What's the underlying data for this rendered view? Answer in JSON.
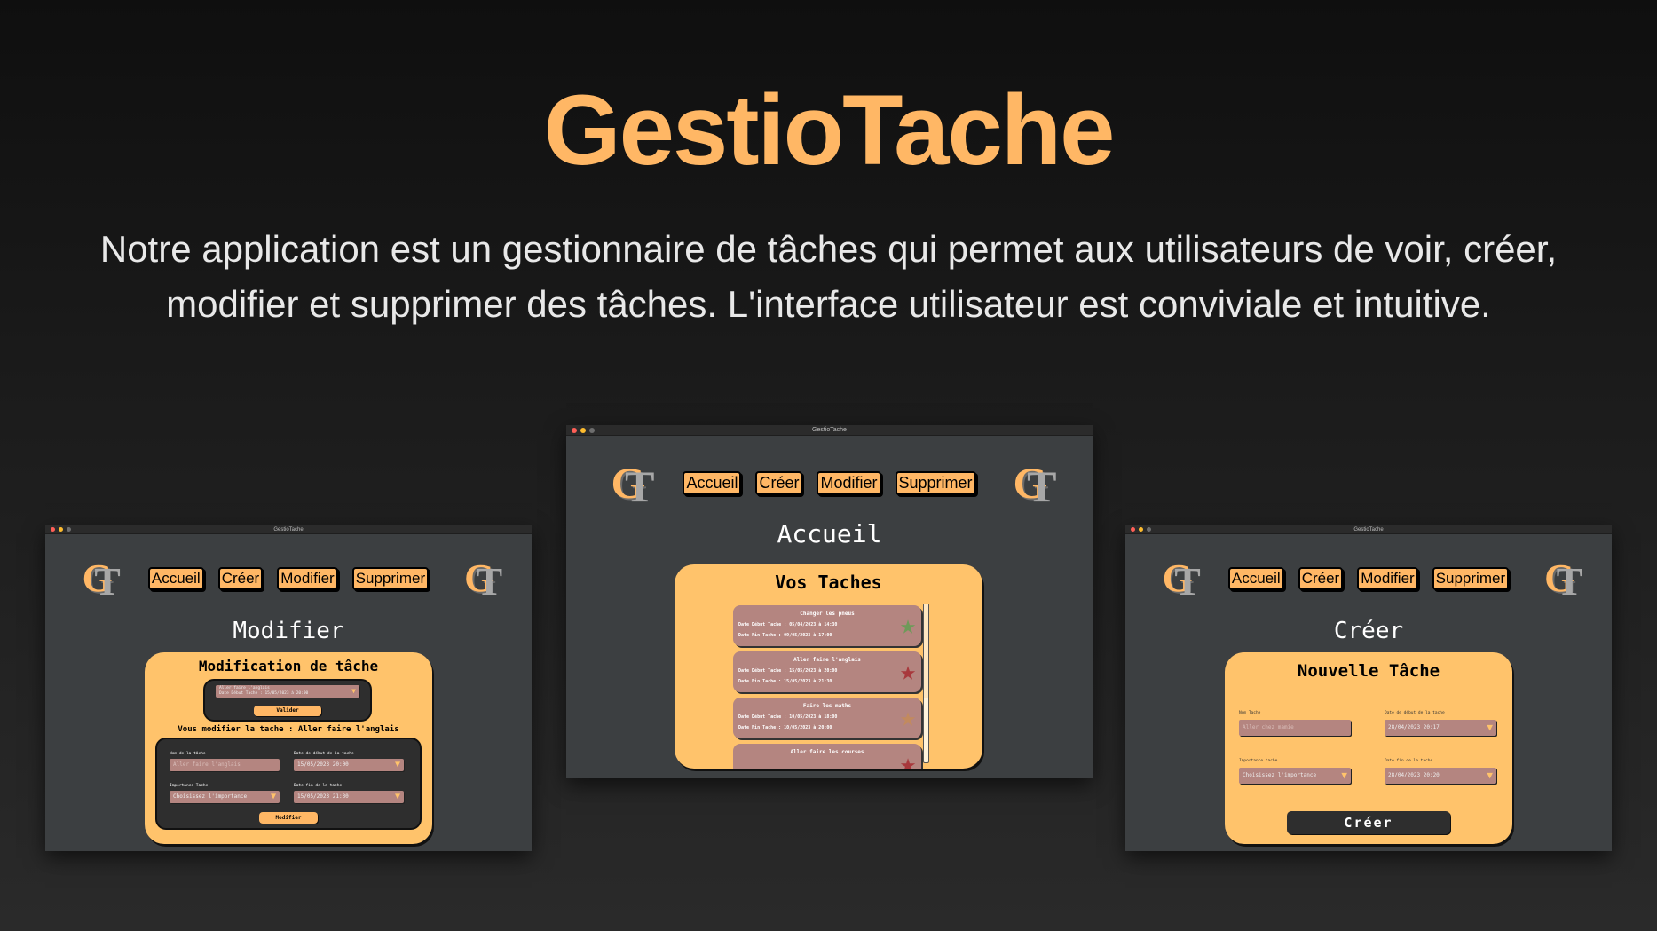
{
  "hero": {
    "title": "GestioTache",
    "description": "Notre application est un gestionnaire de tâches qui permet aux utilisateurs de voir, créer, modifier et supprimer des tâches. L'interface utilisateur est conviviale et intuitive."
  },
  "app": {
    "window_title": "GestioTache",
    "logo_letters": [
      "G",
      "T"
    ],
    "nav": [
      "Accueil",
      "Créer",
      "Modifier",
      "Supprimer"
    ]
  },
  "colors": {
    "accent": "#ffb765",
    "panel": "#ffc36b",
    "card": "#b48580",
    "window": "#3c3f41"
  },
  "modifier": {
    "heading": "Modifier",
    "panel_title": "Modification de tâche",
    "select_line1": "Aller faire l'anglais",
    "select_line2": "Date Début Tache : 15/05/2023 à 20:00",
    "validate": "Valider",
    "info": "Vous modifier la tache : Aller faire l'anglais",
    "name_label": "Nom de la tâche",
    "name_placeholder": "Aller faire l'anglais",
    "start_label": "Date de début de la tache",
    "start_value": "15/05/2023 20:00",
    "importance_label": "Importance Tache",
    "importance_value": "Choisissez l'importance",
    "end_label": "Date fin de la tache",
    "end_value": "15/05/2023 21:30",
    "submit": "Modifier"
  },
  "accueil": {
    "heading": "Accueil",
    "panel_title": "Vos Taches",
    "tasks": [
      {
        "name": "Changer les pneus",
        "start": "Date Début Tache : 05/04/2023 à 14:30",
        "end": "Date Fin Tache : 09/05/2023 à 17:00",
        "star_color": "#6e9a59"
      },
      {
        "name": "Aller faire l'anglais",
        "start": "Date Début Tache : 15/05/2023 à 20:00",
        "end": "Date Fin Tache : 15/05/2023 à 21:30",
        "star_color": "#a8383c"
      },
      {
        "name": "Faire les maths",
        "start": "Date Début Tache : 10/05/2023 à 18:00",
        "end": "Date Fin Tache : 10/05/2023 à 20:00",
        "star_color": "#c28a5e"
      },
      {
        "name": "Aller faire les courses",
        "start": "",
        "end": "",
        "star_color": "#a8383c"
      }
    ]
  },
  "creer": {
    "heading": "Créer",
    "panel_title": "Nouvelle Tâche",
    "name_label": "Nom Tache",
    "name_placeholder": "Aller chez mamie",
    "start_label": "Date de début de la tache",
    "start_value": "28/04/2023 20:17",
    "importance_label": "Importance tache",
    "importance_value": "Choisissez l'importance",
    "end_label": "Date fin de la tache",
    "end_value": "28/04/2023 20:20",
    "submit": "Créer"
  }
}
